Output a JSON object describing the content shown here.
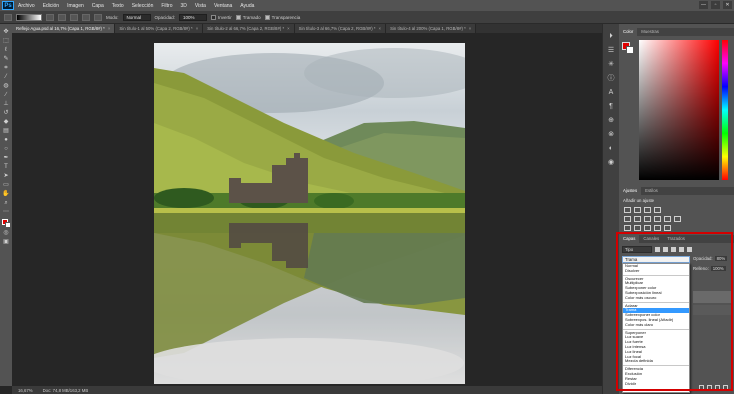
{
  "app": {
    "logo": "Ps"
  },
  "menu": {
    "items": [
      "Archivo",
      "Edición",
      "Imagen",
      "Capa",
      "Texto",
      "Selección",
      "Filtro",
      "3D",
      "Vista",
      "Ventana",
      "Ayuda"
    ]
  },
  "window_controls": [
    "—",
    "▫",
    "✕"
  ],
  "options_bar": {
    "mode_label": "Modo:",
    "mode_value": "Normal",
    "opacity_label": "Opacidad:",
    "opacity_value": "100%",
    "invert_label": "Invertir",
    "invert_checked": false,
    "dither_label": "Tramado",
    "dither_checked": true,
    "transparency_label": "Transparencia",
    "transparency_checked": true
  },
  "doc_tabs": [
    {
      "label": "Reflejo Agua.psd al 16,7% (Capa 1, RGB/8#) *",
      "active": true
    },
    {
      "label": "Sin título-1 al 50% (Capa 2, RGB/8#) *",
      "active": false
    },
    {
      "label": "Sin título-2 al 66,7% (Capa 2, RGB/8#) *",
      "active": false
    },
    {
      "label": "Sin título-3 al 66,7% (Capa 2, RGB/8#) *",
      "active": false
    },
    {
      "label": "Sin título-4 al 200% (Capa 1, RGB/8#) *",
      "active": false
    }
  ],
  "status": {
    "zoom": "16,67%",
    "doc": "Doc: 74,8 MB/163,2 MB"
  },
  "color_panel": {
    "tabs": [
      "Color",
      "Muestras"
    ],
    "fg": "#e10000",
    "bg": "#ffffff"
  },
  "adjust_panel": {
    "tabs": [
      "Ajustes",
      "Estilos"
    ],
    "title": "Añadir un ajuste"
  },
  "layers_panel": {
    "tabs": [
      "Capas",
      "Canales",
      "Trazados"
    ],
    "filter": "Tipo",
    "blend_mode": "Trama",
    "opacity_label": "Opacidad:",
    "opacity_value": "80%",
    "fill_label": "Relleno:",
    "fill_value": "100%",
    "blend_groups": [
      [
        "Normal",
        "Disolver"
      ],
      [
        "Oscurecer",
        "Multiplicar",
        "Subexponer color",
        "Subexposición lineal",
        "Color más oscuro"
      ],
      [
        "Aclarar",
        "Trama",
        "Sobreexponer color",
        "Sobreexpos. lineal (Añadir)",
        "Color más claro"
      ],
      [
        "Superponer",
        "Luz suave",
        "Luz fuerte",
        "Luz intensa",
        "Luz lineal",
        "Luz focal",
        "Mezcla definida"
      ],
      [
        "Diferencia",
        "Exclusión",
        "Restar",
        "Dividir"
      ]
    ],
    "selected_mode": "Trama"
  },
  "colors": {
    "highlight": "#d40000",
    "selection": "#3399ff"
  },
  "tool_icons": [
    "move-icon",
    "marquee-icon",
    "lasso-icon",
    "quick-select-icon",
    "crop-icon",
    "eyedropper-icon",
    "healing-icon",
    "brush-icon",
    "stamp-icon",
    "history-brush-icon",
    "eraser-icon",
    "gradient-icon",
    "blur-icon",
    "dodge-icon",
    "pen-icon",
    "type-icon",
    "path-select-icon",
    "shape-icon",
    "hand-icon",
    "zoom-icon"
  ]
}
